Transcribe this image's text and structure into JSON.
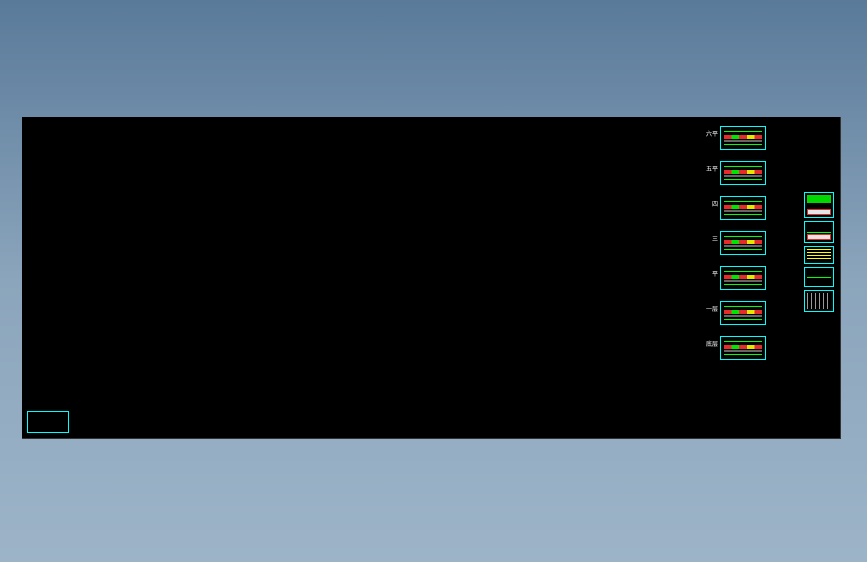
{
  "sheets": [
    {
      "label": "六平"
    },
    {
      "label": "五平"
    },
    {
      "label": "四"
    },
    {
      "label": "三"
    },
    {
      "label": "平"
    },
    {
      "label": "一层"
    },
    {
      "label": "底层"
    }
  ],
  "details": [
    {
      "cls": "a"
    },
    {
      "cls": "b"
    },
    {
      "cls": "c"
    },
    {
      "cls": "d"
    },
    {
      "cls": "e"
    }
  ],
  "colors": {
    "cyan": "#00ffff",
    "green": "#00ff00",
    "red": "#ff3030",
    "yellow": "#ffff00"
  }
}
